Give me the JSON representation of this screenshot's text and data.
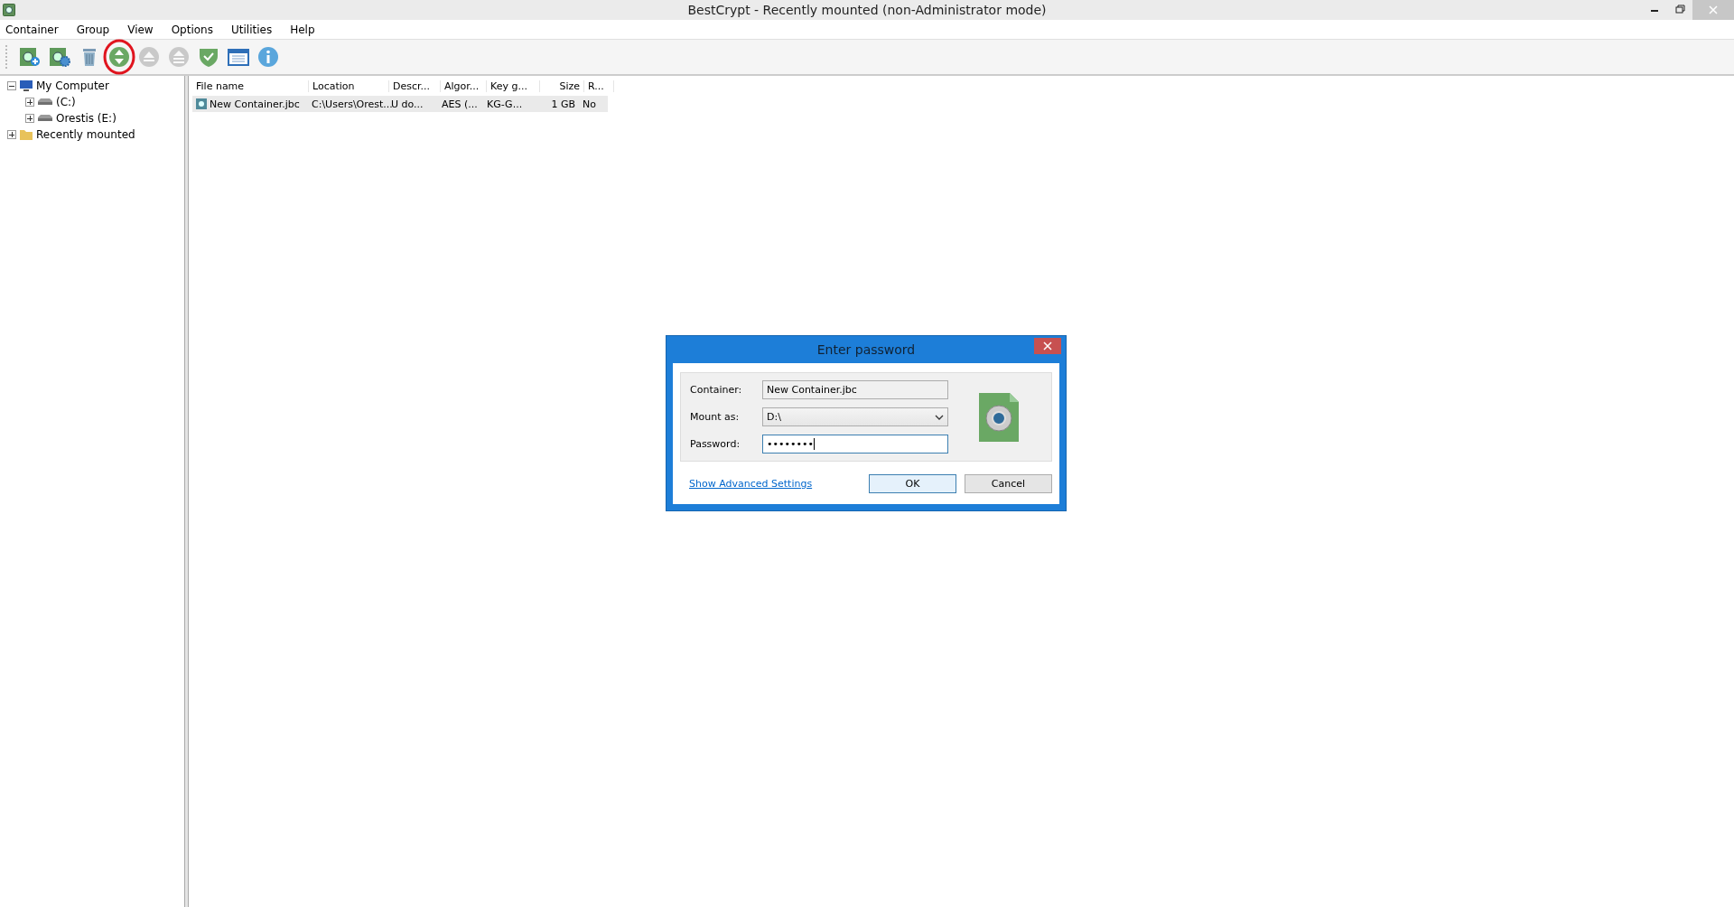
{
  "window": {
    "title": "BestCrypt - Recently mounted (non-Administrator mode)"
  },
  "menu": [
    "Container",
    "Group",
    "View",
    "Options",
    "Utilities",
    "Help"
  ],
  "toolbar": [
    {
      "kind": "create",
      "disabled": false,
      "highlighted": false
    },
    {
      "kind": "settings",
      "disabled": false,
      "highlighted": false
    },
    {
      "kind": "delete",
      "disabled": false,
      "highlighted": false
    },
    {
      "kind": "mount",
      "disabled": false,
      "highlighted": true
    },
    {
      "kind": "dismount",
      "disabled": true,
      "highlighted": false
    },
    {
      "kind": "dismount-all",
      "disabled": true,
      "highlighted": false
    },
    {
      "kind": "shield",
      "disabled": false,
      "highlighted": false
    },
    {
      "kind": "window",
      "disabled": false,
      "highlighted": false
    },
    {
      "kind": "info",
      "disabled": false,
      "highlighted": false
    }
  ],
  "tree": [
    {
      "label": "My Computer",
      "kind": "computer",
      "expanded": true,
      "children": [
        {
          "label": "(C:)",
          "kind": "drive",
          "expanded": false
        },
        {
          "label": "Orestis (E:)",
          "kind": "drive",
          "expanded": false
        }
      ]
    },
    {
      "label": "Recently mounted",
      "kind": "folder",
      "expanded": false
    }
  ],
  "table": {
    "columns": [
      "File name",
      "Location",
      "Descr...",
      "Algor...",
      "Key g...",
      "Size",
      "R..."
    ],
    "rows": [
      {
        "selected": true,
        "cells": [
          "New Container.jbc",
          "C:\\Users\\Orest...",
          "U do...",
          "AES (...",
          "KG-G...",
          "1 GB",
          "No"
        ]
      }
    ]
  },
  "dialog": {
    "title": "Enter password",
    "container": {
      "label": "Container:",
      "value": "New Container.jbc"
    },
    "mount_as": {
      "label": "Mount as:",
      "value": "D:\\"
    },
    "password": {
      "label": "Password:",
      "value": "••••••••"
    },
    "link": "Show Advanced Settings",
    "buttons": [
      "OK",
      "Cancel"
    ]
  }
}
